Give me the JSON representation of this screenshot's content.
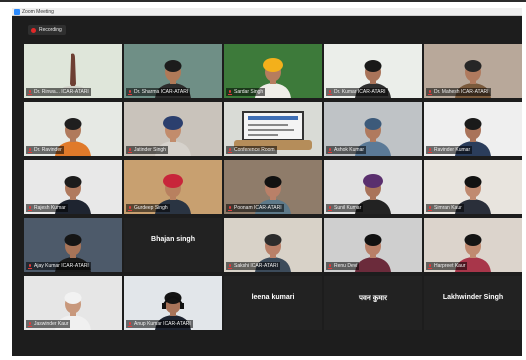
{
  "window": {
    "title": "Zoom Meeting",
    "recording_label": "Recording"
  },
  "participants": [
    {
      "name": "Dr. Rinwa... ICAR-ATARI",
      "bg": "#dfe6da",
      "shirt": "#c9c1b6",
      "skin": "#b98a6e",
      "hair": "#1b1b1b",
      "kind": "vase"
    },
    {
      "name": "Dr. Sharma ICAR-ATARI",
      "bg": "#6f8f86",
      "shirt": "#2c2c2c",
      "skin": "#b07a58",
      "hair": "#1c1c1c",
      "kind": "person"
    },
    {
      "name": "Sardar Singh",
      "bg": "#3d7a3a",
      "shirt": "#efeee8",
      "skin": "#b67d5e",
      "hair": "#f3b01b",
      "kind": "turban"
    },
    {
      "name": "Dr. Kumar ICAR-ATARI",
      "bg": "#ebeeea",
      "shirt": "#2f2f2f",
      "skin": "#a9745a",
      "hair": "#191919",
      "kind": "person"
    },
    {
      "name": "Dr. Mahesh ICAR-ATARI",
      "bg": "#b8a89a",
      "shirt": "#7a5a3c",
      "skin": "#b07a5e",
      "hair": "#262626",
      "kind": "person"
    },
    {
      "name": "Dr. Ravinder",
      "bg": "#e6e9e4",
      "shirt": "#e07a2a",
      "skin": "#b07a5c",
      "hair": "#1f1f1f",
      "kind": "person"
    },
    {
      "name": "Jatinder Singh",
      "bg": "#c9c3bb",
      "shirt": "#d6d2cc",
      "skin": "#c28c6c",
      "hair": "#2b3f6e",
      "kind": "turban"
    },
    {
      "name": "Conference Room",
      "bg": "#d9dbd6",
      "shirt": "#333",
      "skin": "#aa7a5e",
      "hair": "#222",
      "kind": "room"
    },
    {
      "name": "Ashok Kumar",
      "bg": "#bfc3c6",
      "shirt": "#5b7a97",
      "skin": "#b07a5e",
      "hair": "#3c5a7a",
      "kind": "person"
    },
    {
      "name": "Ravinder Kumar",
      "bg": "#efefef",
      "shirt": "#2b3d5b",
      "skin": "#a9735a",
      "hair": "#1a1a1a",
      "kind": "person"
    },
    {
      "name": "Rajesh Kumar",
      "bg": "#e8e8e8",
      "shirt": "#1e2430",
      "skin": "#b07a5e",
      "hair": "#1c1c1c",
      "kind": "person"
    },
    {
      "name": "Gurdeep Singh",
      "bg": "#c8a070",
      "shirt": "#2a3442",
      "skin": "#b8805f",
      "hair": "#c8253a",
      "kind": "turban"
    },
    {
      "name": "Poonam ICAR-ATARI",
      "bg": "#8f7c6a",
      "shirt": "#5e7a8a",
      "skin": "#b98068",
      "hair": "#111",
      "kind": "person"
    },
    {
      "name": "Sunil Kumar",
      "bg": "#e2e2e2",
      "shirt": "#222",
      "skin": "#a9735a",
      "hair": "#5a2f6e",
      "kind": "turban"
    },
    {
      "name": "Simran Kaur",
      "bg": "#e8e4de",
      "shirt": "#2a2f3a",
      "skin": "#c08a70",
      "hair": "#121212",
      "kind": "person"
    },
    {
      "name": "Ajay Kumar ICAR-ATARI",
      "bg": "#4d5a6a",
      "shirt": "#1a1a1a",
      "skin": "#a87458",
      "hair": "#151515",
      "kind": "person"
    },
    {
      "name": "Bhajan singh",
      "bg": "#222222",
      "kind": "name-only"
    },
    {
      "name": "Sakshi ICAR-ATARI",
      "bg": "#d8d2c8",
      "shirt": "#3c4b5a",
      "skin": "#b98068",
      "hair": "#2c2c2c",
      "kind": "person"
    },
    {
      "name": "Renu Devi",
      "bg": "#cfcfcf",
      "shirt": "#6b2b3b",
      "skin": "#b98068",
      "hair": "#111",
      "kind": "person"
    },
    {
      "name": "Harpreet Kaur",
      "bg": "#dcd4cc",
      "shirt": "#a8364a",
      "skin": "#c08a70",
      "hair": "#141414",
      "kind": "person"
    },
    {
      "name": "Jaswinder Kaur",
      "bg": "#e6e6e6",
      "shirt": "#f0f0f0",
      "skin": "#c8987c",
      "hair": "#f2f2f2",
      "kind": "person"
    },
    {
      "name": "Anup Kumar ICAR-ATARI",
      "bg": "#e2e6ea",
      "shirt": "#1d2330",
      "skin": "#a8745a",
      "hair": "#141414",
      "kind": "headset"
    },
    {
      "name": "leena kumari",
      "bg": "#222222",
      "kind": "name-only"
    },
    {
      "name": "पवन कुमार",
      "bg": "#222222",
      "kind": "name-only"
    },
    {
      "name": "Lakhwinder Singh",
      "bg": "#222222",
      "kind": "name-only"
    }
  ]
}
